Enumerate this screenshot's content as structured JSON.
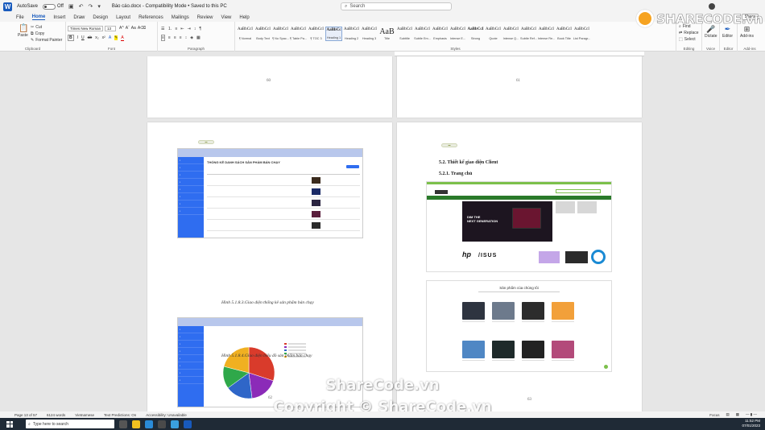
{
  "titlebar": {
    "autosave": "AutoSave",
    "autosave_state": "Off",
    "doc_title": "Báo cáo.docx - Compatibility Mode • Saved to this PC",
    "search_placeholder": "Search"
  },
  "tabs": [
    "File",
    "Home",
    "Insert",
    "Draw",
    "Design",
    "Layout",
    "References",
    "Mailings",
    "Review",
    "View",
    "Help"
  ],
  "active_tab": "Home",
  "ribbon": {
    "clipboard": {
      "paste": "Paste",
      "cut": "Cut",
      "copy": "Copy",
      "format_painter": "Format Painter",
      "label": "Clipboard"
    },
    "font": {
      "name": "Times New Roman",
      "size": "13",
      "label": "Font"
    },
    "paragraph": {
      "label": "Paragraph"
    },
    "styles": {
      "label": "Styles",
      "items": [
        {
          "sample": "AaBbCcI",
          "name": "¶ Normal"
        },
        {
          "sample": "AaBbCcI",
          "name": "Body Text"
        },
        {
          "sample": "AaBbCcI",
          "name": "¶ No Spac..."
        },
        {
          "sample": "AaBbCcI",
          "name": "¶ Table Pa..."
        },
        {
          "sample": "AaBbCcI",
          "name": "¶ TOC 3"
        },
        {
          "sample": "AaBbCc",
          "name": "Heading 1"
        },
        {
          "sample": "AaBbCcI",
          "name": "Heading 2"
        },
        {
          "sample": "AaBbCcI",
          "name": "Heading 3"
        },
        {
          "sample": "AaB",
          "name": "Title"
        },
        {
          "sample": "AaBbCcI",
          "name": "Subtitle"
        },
        {
          "sample": "AaBbCcI",
          "name": "Subtle Em..."
        },
        {
          "sample": "AaBbCcI",
          "name": "Emphasis"
        },
        {
          "sample": "AaBbCcI",
          "name": "Intense E..."
        },
        {
          "sample": "AaBbCcI",
          "name": "Strong"
        },
        {
          "sample": "AaBbCcI",
          "name": "Quote"
        },
        {
          "sample": "AaBbCcI",
          "name": "Intense Q..."
        },
        {
          "sample": "AaBbCcI",
          "name": "Subtle Ref..."
        },
        {
          "sample": "AaBbCcI",
          "name": "Intense Re..."
        },
        {
          "sample": "AaBbCcI",
          "name": "Book Title"
        },
        {
          "sample": "AaBbCcI",
          "name": "List Paragr..."
        }
      ]
    },
    "editing": {
      "find": "Find",
      "replace": "Replace",
      "select": "Select",
      "label": "Editing"
    },
    "voice": {
      "dictate": "Dictate",
      "label": "Voice"
    },
    "editor": {
      "name": "Editor",
      "label": "Editor"
    },
    "addins": {
      "name": "Add-ins",
      "label": "Add-ins"
    },
    "share": "Share"
  },
  "pages": {
    "p60": {
      "number": "60"
    },
    "p61": {
      "number": "61"
    },
    "p62": {
      "number": "62",
      "screen1": {
        "title": "THỐNG KÊ DANH SÁCH SẢN PHẨM BÁN CHẠY"
      },
      "caption1": "Hình 5.1.8.3.Giao diện thống kê sản phẩm bán chạy",
      "caption2": "Hình 5.1.8.4.Giao diện biểu đồ sản phẩm bán chạy",
      "pie_slices": [
        {
          "label": "A",
          "value": 30,
          "color": "#d93b2b"
        },
        {
          "label": "B",
          "value": 18,
          "color": "#8b2bb8"
        },
        {
          "label": "C",
          "value": 17,
          "color": "#2f66c8"
        },
        {
          "label": "D",
          "value": 14,
          "color": "#2fa84a"
        },
        {
          "label": "E",
          "value": 21,
          "color": "#f0b021"
        }
      ]
    },
    "p63": {
      "number": "63",
      "heading1": "5.2. Thiết kế giao diện Client",
      "heading2": "5.2.1. Trang chủ",
      "banner_line1": "DIM THE",
      "banner_line2": "NEXT GENERATION",
      "brand_asus": "/ISUS",
      "products_title": "Sản phẩm của chúng tôi"
    }
  },
  "watermark": {
    "logo_text": "SHARECODE.vn",
    "center_text": "ShareCode.vn",
    "copyright": "Copyright © ShareCode.vn"
  },
  "statusbar": {
    "page": "Page 13 of 57",
    "words": "6124 words",
    "language": "Vietnamese",
    "predictions": "Text Predictions: On",
    "accessibility": "Accessibility: Unavailable",
    "focus": "Focus"
  },
  "taskbar": {
    "search_placeholder": "Type here to search",
    "time": "11:52 PM",
    "date": "07/01/2023"
  }
}
